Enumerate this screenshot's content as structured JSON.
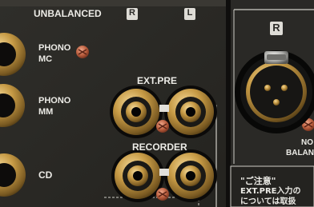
{
  "photo": {
    "subject": "amplifier rear panel close-up",
    "jack_metal": "#c49a4a",
    "panel_color": "#2b2a27",
    "label_color": "#ecebe6"
  },
  "labels": {
    "unbalanced": "UNBALANCED",
    "badge_r": "R",
    "badge_l": "L",
    "phono_mc_line1": "PHONO",
    "phono_mc_line2": "MC",
    "phono_mm_line1": "PHONO",
    "phono_mm_line2": "MM",
    "cd": "CD",
    "ext_pre": "EXT.PRE",
    "recorder": "RECORDER",
    "xlr_r": "R",
    "balanced_no": "NO",
    "balanced": "BALAN",
    "notice_title": "\"ご注意\"",
    "notice_line1": "EXT.PRE入力の",
    "notice_line2": "については取扱"
  }
}
